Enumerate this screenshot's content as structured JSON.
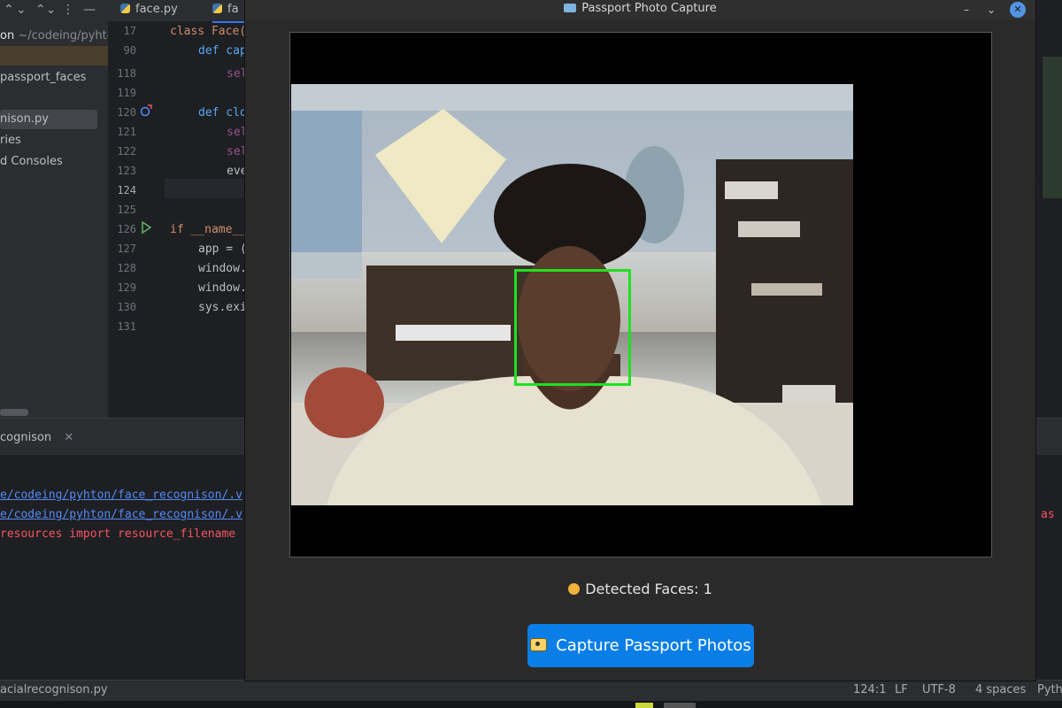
{
  "ide": {
    "toolbar_glyphs": [
      "⌃",
      "⌄",
      "⌃⌄",
      "⋮",
      "—"
    ],
    "project_tree": [
      {
        "label": "on",
        "path": "~/codeing/pyhto"
      },
      {
        "label": "passport_faces"
      },
      {
        "label": "nison.py"
      },
      {
        "label": "ries"
      },
      {
        "label": "d Consoles"
      }
    ],
    "editor_tabs": [
      "face.py",
      "fa"
    ],
    "line_numbers": [
      "17",
      "90",
      "118",
      "119",
      "120",
      "121",
      "122",
      "123",
      "124",
      "125",
      "126",
      "127",
      "128",
      "129",
      "130",
      "131"
    ],
    "code_lines": [
      "class Face(",
      "def cap",
      "sel",
      "",
      "def clo",
      "sel",
      "sel",
      "eve",
      "",
      "",
      "if __name__",
      "app = (",
      "window.",
      "window.",
      "sys.exi",
      ""
    ],
    "run_tab_label": "cognison",
    "console_lines": [
      "e/codeing/pyhton/face_recognison/.v",
      "e/codeing/pyhton/face_recognison/.v",
      "resources import resource_filename"
    ],
    "console_right": "as",
    "status": {
      "file": "acialrecognison.py",
      "position": "124:1",
      "line_sep": "LF",
      "encoding": "UTF-8",
      "indent": "4 spaces",
      "interpreter": "Pyth"
    }
  },
  "dialog": {
    "title": "Passport Photo Capture",
    "window_controls": [
      "–",
      "⌄",
      "✕"
    ],
    "detected_faces_label": "Detected Faces: 1",
    "capture_button_label": "Capture Passport Photos"
  },
  "colors": {
    "accent_button": "#0a7ee6",
    "face_box": "#20e020",
    "dialog_bg": "#2a2a2a",
    "ide_bg": "#1e1f22"
  }
}
